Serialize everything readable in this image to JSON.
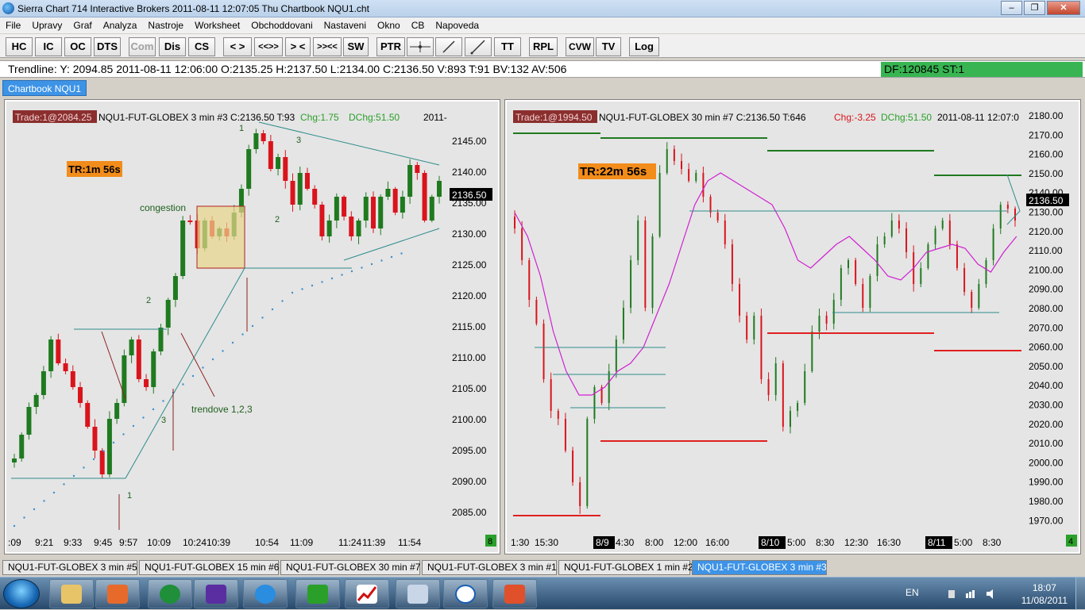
{
  "window": {
    "title": "Sierra Chart 714 Interactive Brokers 2011-08-11  12:07:05  Thu    Chartbook NQU1.cht",
    "min": "–",
    "max": "❐",
    "close": "✕"
  },
  "menu": [
    "File",
    "Upravy",
    "Graf",
    "Analyza",
    "Nastroje",
    "Worksheet",
    "Obchoddovani",
    "Nastaveni",
    "Okno",
    "CB",
    "Napoveda"
  ],
  "toolbar": [
    "HC",
    "IC",
    "OC",
    "DTS",
    "Com",
    "Dis",
    "CS",
    "< >",
    "<<>>",
    "> <",
    ">><<",
    "SW",
    "PTR",
    "",
    "",
    "",
    "TT",
    "RPL",
    "CVW",
    "TV",
    "Log"
  ],
  "infobar": {
    "trendline": "Trendline: Y: 2094.85  2011-08-11  12:06:00  O:2135.25  H:2137.50  L:2134.00  C:2136.50  V:893  T:91  BV:132  AV:506",
    "df": "DF:120845  ST:1"
  },
  "chartbook_tab": "Chartbook NQU1",
  "colors": {
    "up": "#1f7a1f",
    "down": "#d9141c",
    "teal": "#2e8b8b",
    "magenta": "#d020d0",
    "green_line": "#1f7a1f",
    "red_line": "#e02020",
    "badge": "#f28c1a",
    "trade": "#8b2e2e"
  },
  "chart_left": {
    "trade": "Trade:1@2084.25",
    "header": "NQU1-FUT-GLOBEX  3 min    #3 C:2136.50 T:93",
    "chg": "Chg:1.75",
    "dchg": "DChg:51.50",
    "date": "2011-",
    "badge": "TR:1m 56s",
    "price_tag": "2136.50",
    "corner": "8",
    "y_labels": [
      "2145.00",
      "2140.00",
      "2135.00",
      "2130.00",
      "2125.00",
      "2120.00",
      "2115.00",
      "2110.00",
      "2105.00",
      "2100.00",
      "2095.00",
      "2090.00",
      "2085.00"
    ],
    "x_labels": [
      ":09",
      "9:21",
      "9:33",
      "9:45",
      "9:57",
      "10:09",
      "10:24",
      "10:39",
      "10:54",
      "11:09",
      "11:24",
      "11:39",
      "11:54"
    ],
    "annotations": {
      "congestion": "congestion",
      "trendove": "trendove 1,2,3",
      "n1": "1",
      "n2": "2",
      "n3": "3"
    }
  },
  "chart_right": {
    "trade": "Trade:1@1994.50",
    "header": "NQU1-FUT-GLOBEX  30 min    #7 C:2136.50 T:646",
    "chg": "Chg:-3.25",
    "dchg": "DChg:51.50",
    "date": "2011-08-11  12:07:0",
    "badge": "TR:22m 56s",
    "price_tag": "2136.50",
    "corner": "4",
    "y_labels": [
      "2180.00",
      "2170.00",
      "2160.00",
      "2150.00",
      "2140.00",
      "2130.00",
      "2120.00",
      "2110.00",
      "2100.00",
      "2090.00",
      "2080.00",
      "2070.00",
      "2060.00",
      "2050.00",
      "2040.00",
      "2030.00",
      "2020.00",
      "2010.00",
      "2000.00",
      "1990.00",
      "1980.00",
      "1970.00"
    ],
    "x_labels": [
      "1:30",
      "15:30",
      "8/9",
      "4:30",
      "8:00",
      "12:00",
      "16:00",
      "8/10",
      "5:00",
      "8:30",
      "12:30",
      "16:30",
      "8/11",
      "5:00",
      "8:30"
    ]
  },
  "chart_tabs": [
    "NQU1-FUT-GLOBEX  3 min    #5",
    "NQU1-FUT-GLOBEX  15 min    #6",
    "NQU1-FUT-GLOBEX  30 min    #7",
    "NQU1-FUT-GLOBEX  3 min    #1",
    "NQU1-FUT-GLOBEX  1 min    #2",
    "NQU1-FUT-GLOBEX  3 min    #3"
  ],
  "taskbar": {
    "lang": "EN",
    "time": "18:07",
    "date": "11/08/2011",
    "apps": [
      "explorer-icon",
      "media-player-icon",
      "globe-icon",
      "app-icon",
      "internet-explorer-icon",
      "green-app-icon",
      "chart-icon",
      "notepad-icon",
      "e-icon",
      "eye-icon"
    ]
  }
}
